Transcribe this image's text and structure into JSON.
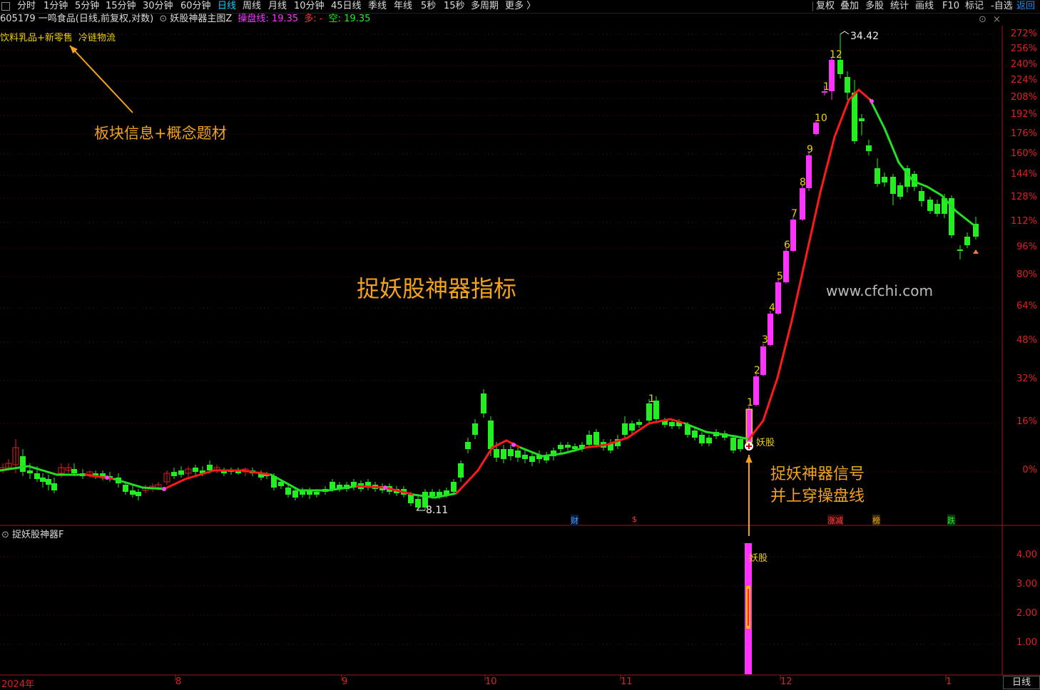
{
  "toolbar": {
    "periods": [
      "分时",
      "1分钟",
      "5分钟",
      "15分钟",
      "30分钟",
      "60分钟",
      "日线",
      "周线",
      "月线",
      "10分钟",
      "45日线",
      "季线",
      "年线",
      "5秒",
      "15秒",
      "多周期",
      "更多 〉"
    ],
    "active_period": "日线",
    "right_buttons": [
      "复权",
      "叠加",
      "多股",
      "统计",
      "画线",
      "F10",
      "标记",
      "自选"
    ],
    "back_label": "返回"
  },
  "legend": {
    "stock": "605179 一鸣食品(日线,前复权,对数)",
    "indicator": "妖股神器主图Z",
    "line_label": "操盘线: 19.35",
    "bull_label": "多: -",
    "bear_label": "空: 19.35",
    "concepts": "饮料乳品+新零售",
    "concept2": "冷链物流"
  },
  "annotations": {
    "sector_info": "板块信息+概念题材",
    "title": "捉妖股神器指标",
    "signal_line1": "捉妖神器信号",
    "signal_line2": "并上穿操盘线",
    "watermark": "www.cfchi.com",
    "yaogu_main": "妖股",
    "yaogu_sub": "妖股",
    "high_label": "34.42",
    "low_label": "8.11"
  },
  "event_tags": {
    "cai": "财",
    "dollar": "$",
    "zhangjian": "涨减",
    "bang": "榜",
    "die": "跌"
  },
  "sub_panel": {
    "title": "捉妖股神器F"
  },
  "y_axis_main": [
    "272%",
    "256%",
    "240%",
    "224%",
    "208%",
    "192%",
    "176%",
    "160%",
    "144%",
    "128%",
    "112%",
    "96%",
    "80%",
    "64%",
    "48%",
    "32%",
    "16%",
    "0%"
  ],
  "y_axis_sub": [
    "4.00",
    "3.00",
    "2.00",
    "1.00"
  ],
  "x_axis": [
    "2024年",
    "8",
    "9",
    "10",
    "11",
    "12",
    "1"
  ],
  "bottom_tab": "日线",
  "candle_counts": [
    "1",
    "2",
    "3",
    "4",
    "5",
    "6",
    "7",
    "8",
    "9",
    "10",
    "1",
    "12"
  ],
  "count_small_1": "1",
  "colors": {
    "up": "#ff33ff",
    "down": "#22ee22",
    "up_hollow": "#e02020",
    "line_up": "#ff1a1a",
    "line_down": "#22e022",
    "accent": "#f3a21b",
    "axis": "#d22222",
    "active_tab": "#1ec8ff"
  },
  "chart_data": {
    "type": "candlestick",
    "scale": "log",
    "ylim": [
      8.11,
      34.42
    ],
    "x": [
      "2024年",
      "8",
      "9",
      "10",
      "11",
      "12",
      "1"
    ],
    "series": [
      {
        "name": "操盘线",
        "last": 19.35
      }
    ],
    "signal_value_steps": [
      1,
      2,
      3,
      4.5
    ],
    "extremes": {
      "high": 34.42,
      "low": 8.11
    }
  }
}
